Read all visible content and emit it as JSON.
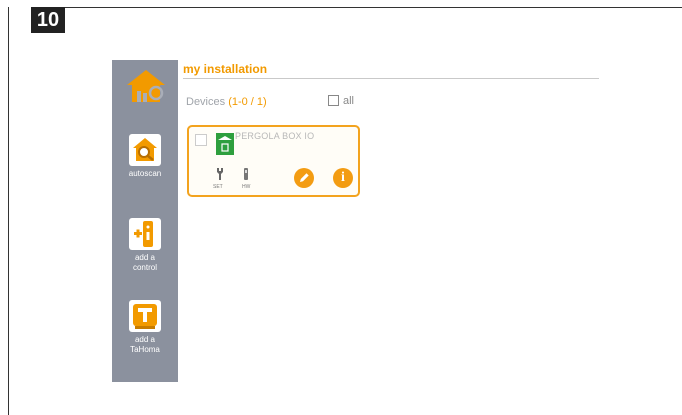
{
  "step_number": "10",
  "sidebar": {
    "items": [
      {
        "label": "autoscan",
        "icon": "magnifier-house-icon"
      },
      {
        "label": "add a control",
        "icon": "remote-control-icon"
      },
      {
        "label": "add a TaHoma",
        "icon": "tahoma-box-icon"
      }
    ]
  },
  "main": {
    "title": "my installation",
    "devices_label": "Devices",
    "devices_count": "(1-0 / 1)",
    "all_label": "all"
  },
  "device": {
    "name": "PERGOLA BOX IO",
    "set_label": "SET",
    "hw_label": "HW",
    "edit_icon": "pencil-icon",
    "info_icon": "info-icon"
  },
  "colors": {
    "accent": "#f29a00",
    "sidebar": "#8b919e",
    "device_icon": "#2e9f3e"
  }
}
